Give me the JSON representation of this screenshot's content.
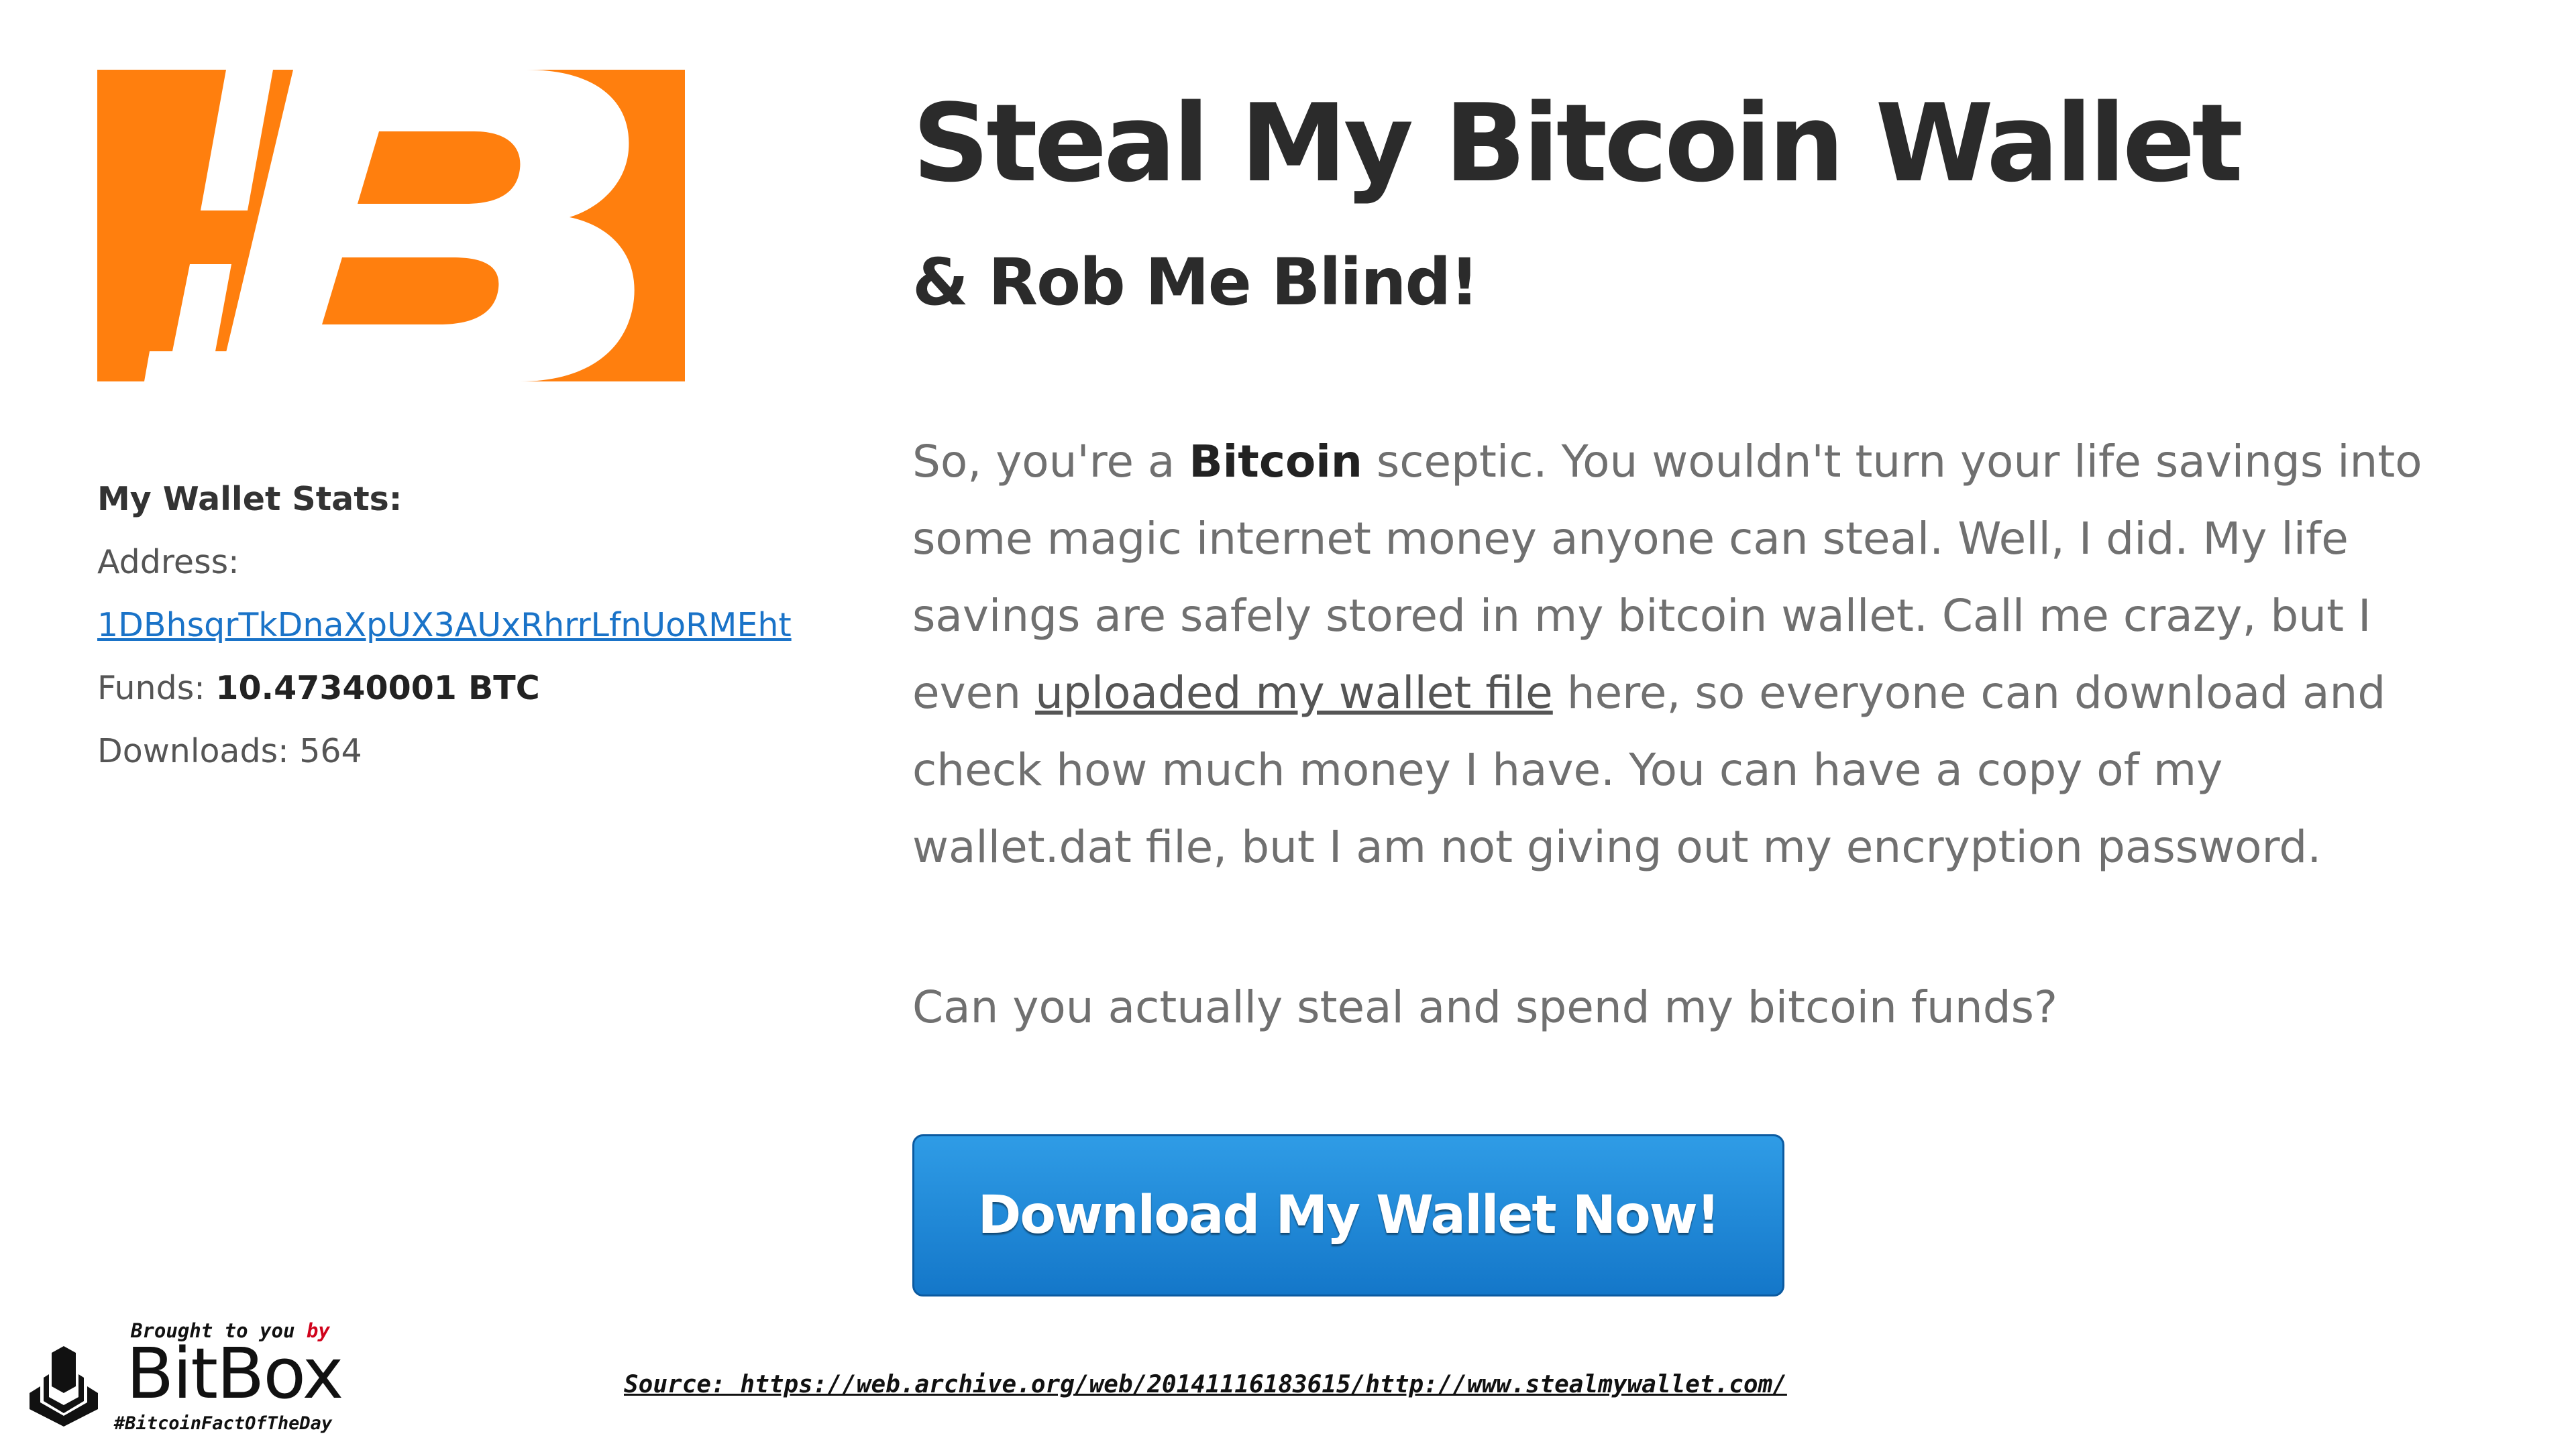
{
  "colors": {
    "brand_orange": "#ff7f0e",
    "button_blue": "#1a85d6",
    "link_blue": "#1a73c8",
    "bitbox_red": "#d0021b"
  },
  "header": {
    "title": "Steal My Bitcoin Wallet",
    "subtitle": "& Rob Me Blind!"
  },
  "stats": {
    "heading": "My Wallet Stats:",
    "address_label": "Address:",
    "address": "1DBhsqrTkDnaXpUX3AUxRhrrLfnUoRMEht",
    "funds_label": "Funds:",
    "funds_value": "10.47340001 BTC",
    "downloads_label": "Downloads:",
    "downloads_value": "564"
  },
  "content": {
    "p1_a": "So, you're a ",
    "p1_bold": "Bitcoin",
    "p1_b": " sceptic. You wouldn't turn your life savings into some magic internet money anyone can steal. Well, I did. My life savings are safely stored in my bitcoin wallet. Call me crazy, but I even ",
    "p1_link": "uploaded my wallet file",
    "p1_c": " here, so everyone can download and check how much money I have. You can have a copy of my wallet.dat file, but I am not giving out my encryption password.",
    "question": "Can you actually steal and spend my bitcoin funds?",
    "download_button": "Download My Wallet Now!"
  },
  "branding": {
    "brought": "Brought to you ",
    "by": "by",
    "name": "BitBox",
    "hashtag": "#BitcoinFactOfTheDay",
    "source": "Source: https://web.archive.org/web/20141116183615/http://www.stealmywallet.com/"
  }
}
